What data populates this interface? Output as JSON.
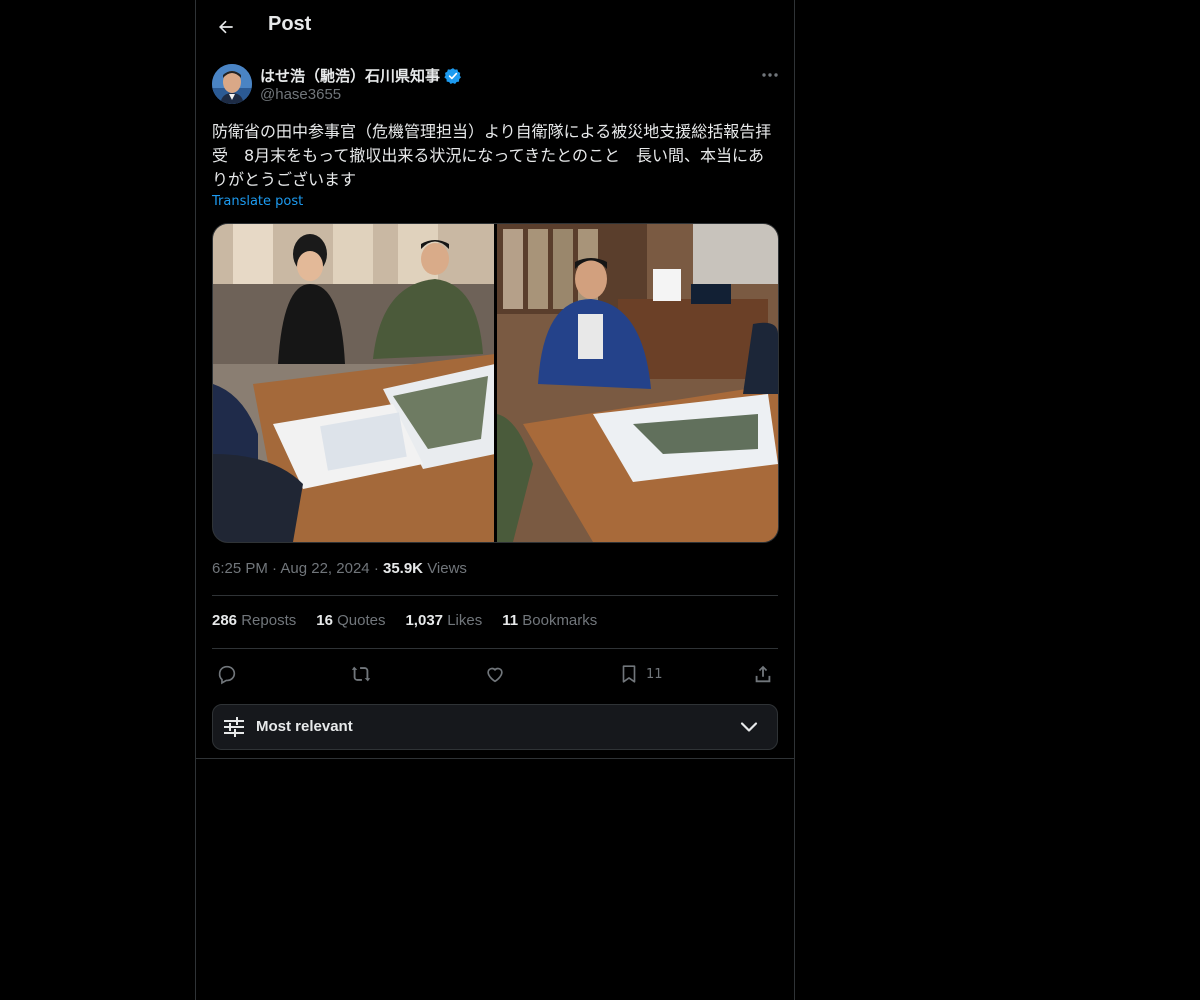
{
  "header": {
    "title": "Post"
  },
  "post": {
    "author_name": "はせ浩（馳浩）石川県知事",
    "handle": "@hase3655",
    "text": "防衛省の田中参事官（危機管理担当）より自衛隊による被災地支援総括報告拝受　8月末をもって撤収出来る状況になってきたとのこと　長い間、本当にありがとうございます",
    "translate": "Translate post",
    "time": "6:25 PM",
    "date": "Aug 22, 2024",
    "views_count": "35.9K",
    "views_label": "Views"
  },
  "stats": {
    "reposts": {
      "count": "286",
      "label": "Reposts"
    },
    "quotes": {
      "count": "16",
      "label": "Quotes"
    },
    "likes": {
      "count": "1,037",
      "label": "Likes"
    },
    "bookmarks": {
      "count": "11",
      "label": "Bookmarks"
    }
  },
  "actions": {
    "bookmark_count": "11"
  },
  "sort": {
    "label": "Most relevant"
  },
  "colors": {
    "accent": "#1d9bf0",
    "verified": "#1d9bf0",
    "muted": "#71767b",
    "border": "#2f3336"
  }
}
